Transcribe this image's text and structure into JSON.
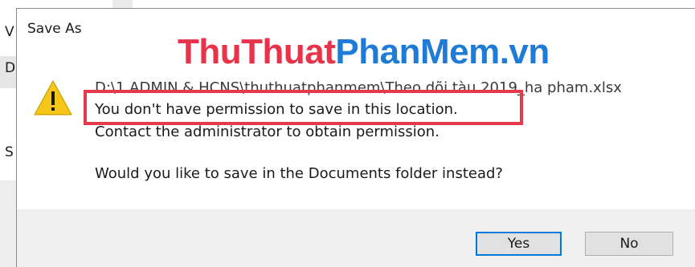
{
  "background_app": {
    "letter_1": "V",
    "letter_2": "D",
    "letter_3": "S"
  },
  "dialog": {
    "title": "Save As",
    "file_path": "D:\\1.ADMIN & HCNS\\thuthuatphanmem\\Theo dõi tàu 2019_ha pham.xlsx",
    "permission_message": "You don't have permission to save in this location.",
    "contact_message": "Contact the administrator to obtain permission.",
    "question": "Would you like to save in the Documents folder instead?",
    "yes_label": "Yes",
    "no_label": "No",
    "icon": "warning-icon"
  },
  "watermark": {
    "part1": "ThuThuat",
    "part2": "PhanMem.vn"
  },
  "colors": {
    "watermark_red": "#e8334a",
    "watermark_blue": "#1f7bd6",
    "highlight": "#e53a4c",
    "warning_yellow": "#f5c518",
    "default_button_border": "#0078d7"
  }
}
